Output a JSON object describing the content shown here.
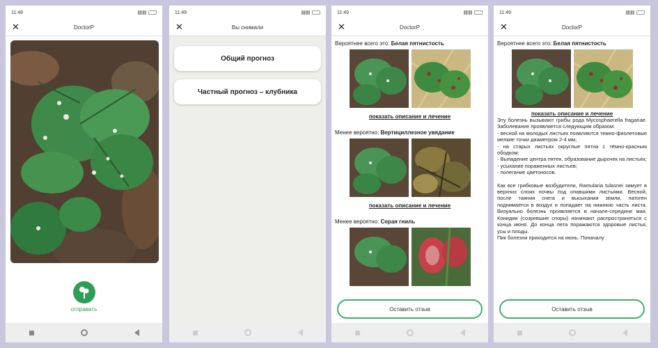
{
  "phones": [
    {
      "time": "11:48",
      "title": "DoctorP",
      "send_label": "отправить"
    },
    {
      "time": "11:49",
      "title": "Вы снимали",
      "buttons": [
        "Общий прогноз",
        "Частный прогноз – клубника"
      ]
    },
    {
      "time": "11:49",
      "title": "DoctorP",
      "results": [
        {
          "prefix": "Вероятнее всего это:",
          "name": "Белая пятнистость",
          "link": "показать описание и лечение"
        },
        {
          "prefix": "Менее вероятно:",
          "name": "Вертициллезное увядание",
          "link": "показать описание и лечение"
        },
        {
          "prefix": "Менее вероятно:",
          "name": "Серая гниль"
        }
      ],
      "feedback": "Оставить отзыв"
    },
    {
      "time": "11:49",
      "title": "DoctorP",
      "prefix": "Вероятнее всего это:",
      "name": "Белая пятнистость",
      "link": "показать описание и лечение",
      "desc": [
        "Эту болезнь вызывают грибы рода Mycosphaerella fragariae. Заболевание проявляется следующим образом:",
        "- весной на молодых листьях появляются темно-фиолетовые мелкие точки диаметром 2-4 мм;",
        "- на старых листьях округлые пятна с тёмно-красным ободком;",
        "- Выпадение центра пятен, образование дырочек на листьях;",
        "- усыхание пораженных листьев;",
        "- полегание цветоносов."
      ],
      "desc2": [
        "Как все грибковые возбудители, Ramularia tulasnei зимует в верхних слоях почвы под опавшими листьями. Весной, после таяния снега и высыхания земли, патоген поднимается в воздух и попадает на нижнюю часть листа. Визуально болезнь проявляется в начале-середине мая. Конидии (созревшие споры) начинают распространяться с конца июня. До конца лета поражаются здоровые листья, усы и плоды.",
        "Пик болезни приходится на июнь. Поначалу"
      ],
      "feedback": "Оставить отзыв"
    }
  ]
}
